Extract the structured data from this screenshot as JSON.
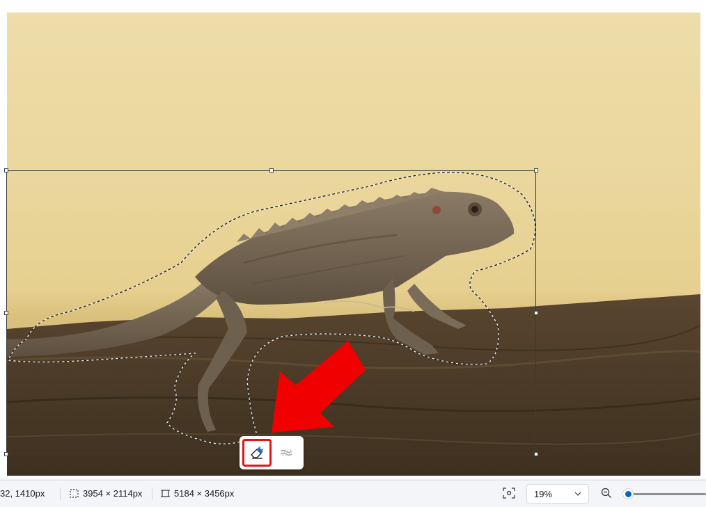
{
  "status_bar": {
    "cursor_position": "32, 1410px",
    "selection_size": "3954 × 2114px",
    "image_size": "5184 × 3456px",
    "zoom_value": "19%"
  },
  "floating_toolbar": {
    "erase_tool": "eraser-icon",
    "fill_tool": "generative-fill-icon"
  },
  "annotation": {
    "arrow_color": "#f00000",
    "highlight_color": "#e8121a"
  },
  "icons": {
    "cursor": "crosshair-icon",
    "selection": "selection-marquee-icon",
    "image_size": "image-frame-icon",
    "fit": "fit-to-window-icon",
    "zoom_out": "zoom-out-icon",
    "dropdown": "chevron-down-icon"
  }
}
